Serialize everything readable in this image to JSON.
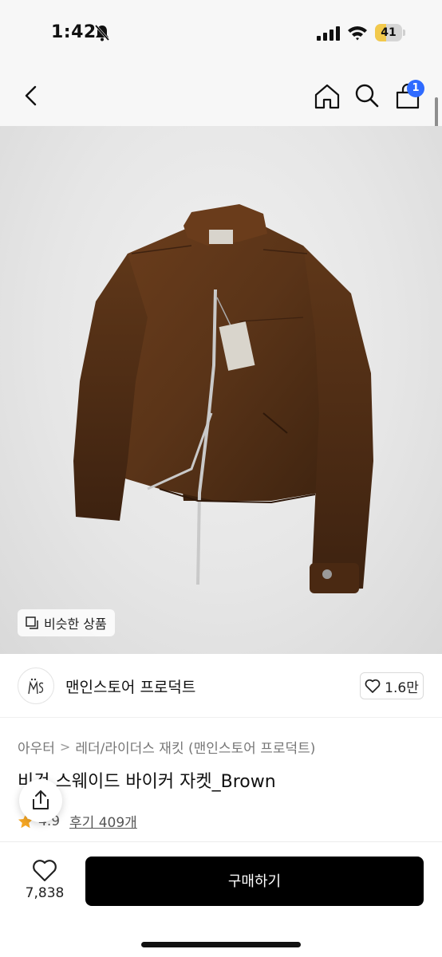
{
  "status_bar": {
    "time": "1:42",
    "battery": "41",
    "battery_level": 0.41
  },
  "nav": {
    "cart_count": "1"
  },
  "image": {
    "similar_label": "비슷한 상품"
  },
  "store": {
    "logo_text": "M̈S",
    "name": "맨인스토어 프로덕트",
    "likes": "1.6만"
  },
  "breadcrumb": {
    "category": "아우터",
    "separator": ">",
    "subcategory": "레더/라이더스 재킷 (맨인스토어 프로덕트)"
  },
  "product": {
    "title": "비건 스웨이드 바이커 자켓_Brown",
    "rating": "4.9",
    "reviews": "후기 409개"
  },
  "bottom_bar": {
    "wish_count": "7,838",
    "buy_label": "구매하기"
  },
  "colors": {
    "accent": "#2f6bff",
    "jacket": "#5a3418",
    "buy_button": "#000000",
    "star": "#f5a623"
  }
}
